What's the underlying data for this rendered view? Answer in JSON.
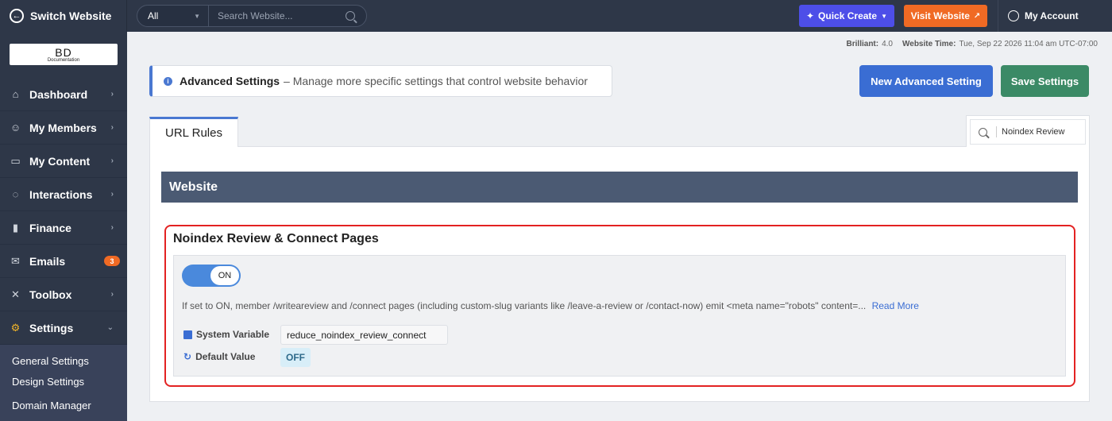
{
  "topbar": {
    "switch_label": "Switch Website",
    "search_scope": "All",
    "search_placeholder": "Search Website...",
    "quick_create": "Quick Create",
    "visit_website": "Visit Website",
    "my_account": "My Account"
  },
  "logo": {
    "big": "BD",
    "small": "Documentation"
  },
  "sidebar": {
    "items": [
      {
        "label": "Dashboard",
        "icon": "home-icon"
      },
      {
        "label": "My Members",
        "icon": "users-icon"
      },
      {
        "label": "My Content",
        "icon": "folder-icon"
      },
      {
        "label": "Interactions",
        "icon": "chat-icon"
      },
      {
        "label": "Finance",
        "icon": "chart-icon"
      },
      {
        "label": "Emails",
        "icon": "mail-icon",
        "badge": "3"
      },
      {
        "label": "Toolbox",
        "icon": "tools-icon"
      },
      {
        "label": "Settings",
        "icon": "gear-icon"
      }
    ],
    "subitems": [
      "General Settings",
      "Design Settings",
      "Domain Manager"
    ]
  },
  "meta": {
    "brilliant_label": "Brilliant:",
    "brilliant_value": "4.0",
    "time_label": "Website Time:",
    "time_value": "Tue, Sep 22 2026 11:04 am UTC-07:00"
  },
  "header": {
    "title": "Advanced Settings",
    "subtitle": "– Manage more specific settings that control website behavior",
    "new_button": "New Advanced Setting",
    "save_button": "Save Settings"
  },
  "tabs": {
    "active": "URL Rules"
  },
  "filter": {
    "value": "Noindex Review"
  },
  "section": {
    "title": "Website"
  },
  "setting": {
    "title": "Noindex Review & Connect Pages",
    "toggle_state": "ON",
    "description": "If set to ON, member /writeareview and /connect pages (including custom-slug variants like /leave-a-review or /contact-now) emit <meta name=\"robots\" content=...",
    "read_more": "Read More",
    "system_variable_label": "System Variable",
    "system_variable_value": "reduce_noindex_review_connect",
    "default_value_label": "Default Value",
    "default_value": "OFF"
  },
  "colors": {
    "topbar": "#2e3748",
    "quick_create": "#4d4ee8",
    "visit_website": "#f06a24",
    "primary": "#3a6dd3",
    "save": "#3b8a66",
    "highlight": "#e32222"
  }
}
